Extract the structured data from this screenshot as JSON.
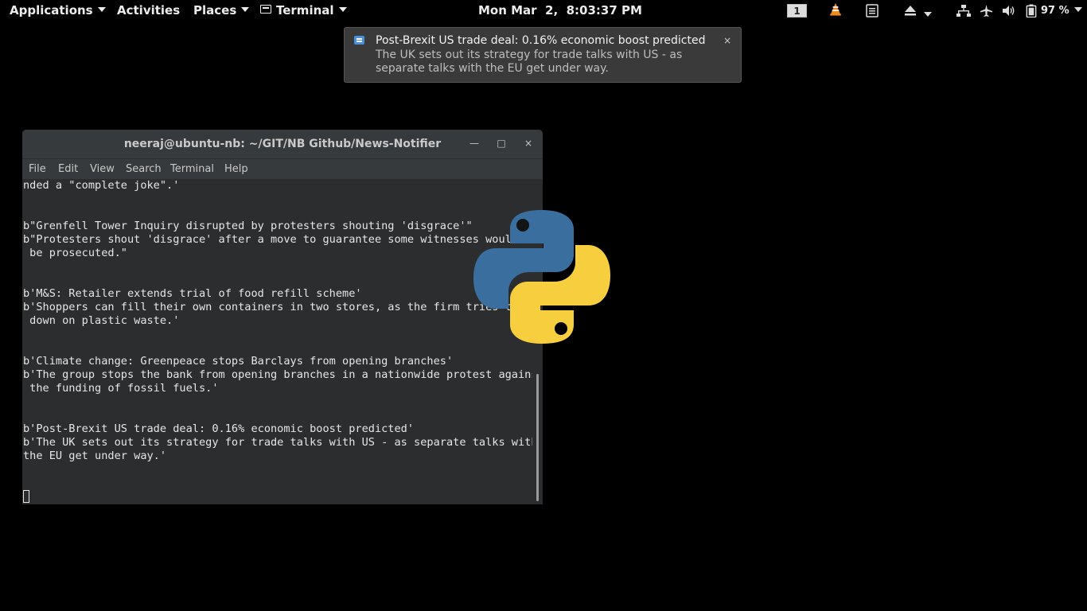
{
  "panel": {
    "applications": "Applications",
    "activities": "Activities",
    "places": "Places",
    "terminal": "Terminal",
    "clock": "Mon Mar  2,  8:03:37 PM",
    "workspace": "1",
    "battery": "97 %"
  },
  "notification": {
    "title": "Post-Brexit US trade deal: 0.16% economic boost predicted",
    "body": "The UK sets out its strategy for trade talks with US - as separate talks with the EU get under way.",
    "close": "×"
  },
  "window": {
    "title": "neeraj@ubuntu-nb: ~/GIT/NB Github/News-Notifier",
    "minimize": "—",
    "maximize": "□",
    "close": "×",
    "menu": [
      "File",
      "Edit",
      "View",
      "Search",
      "Terminal",
      "Help"
    ]
  },
  "terminal_lines": [
    "nded a \"complete joke\".'",
    "b\"Grenfell Tower Inquiry disrupted by protesters shouting 'disgrace'\"",
    "b\"Protesters shout 'disgrace' after a move to guarantee some witnesses would not",
    " be prosecuted.\"",
    "b'M&S: Retailer extends trial of food refill scheme'",
    "b'Shoppers can fill their own containers in two stores, as the firm tries to cut",
    " down on plastic waste.'",
    "b'Climate change: Greenpeace stops Barclays from opening branches'",
    "b'The group stops the bank from opening branches in a nationwide protest against",
    " the funding of fossil fuels.'",
    "b'Post-Brexit US trade deal: 0.16% economic boost predicted'",
    "b'The UK sets out its strategy for trade talks with US - as separate talks with",
    "the EU get under way.'"
  ],
  "colors": {
    "python_blue": "#3a6e9f",
    "python_yellow": "#f7ce3e"
  }
}
